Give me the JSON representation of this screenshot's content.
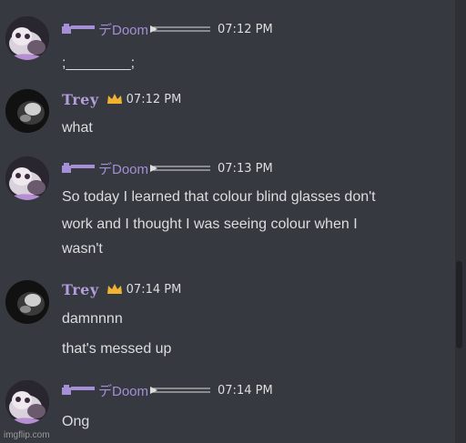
{
  "messages": [
    {
      "author": "デDoom",
      "author_style": "doom",
      "time": "07:12 PM",
      "avatar": "cat-avatar-icon",
      "lines": [
        ";________;"
      ]
    },
    {
      "author": "Trey",
      "author_style": "trey",
      "time": "07:12 PM",
      "avatar": "dark-cat-avatar-icon",
      "lines": [
        "what"
      ]
    },
    {
      "author": "デDoom",
      "author_style": "doom",
      "time": "07:13 PM",
      "avatar": "cat-avatar-icon",
      "lines": [
        "So today I learned that colour blind glasses don't",
        "work and I thought I was seeing colour when I",
        "wasn't"
      ]
    },
    {
      "author": "Trey",
      "author_style": "trey",
      "time": "07:14 PM",
      "avatar": "dark-cat-avatar-icon",
      "lines": [
        "damnnnn",
        "that's messed up"
      ]
    },
    {
      "author": "デDoom",
      "author_style": "doom",
      "time": "07:14 PM",
      "avatar": "cat-avatar-icon",
      "lines": [
        "Ong"
      ]
    }
  ],
  "watermark": "imgflip.com",
  "colors": {
    "background": "#36393f",
    "doom_name": "#a58fd6",
    "trey_name": "#b39ddb",
    "crown": "#f0b232",
    "text": "#dcddde"
  }
}
